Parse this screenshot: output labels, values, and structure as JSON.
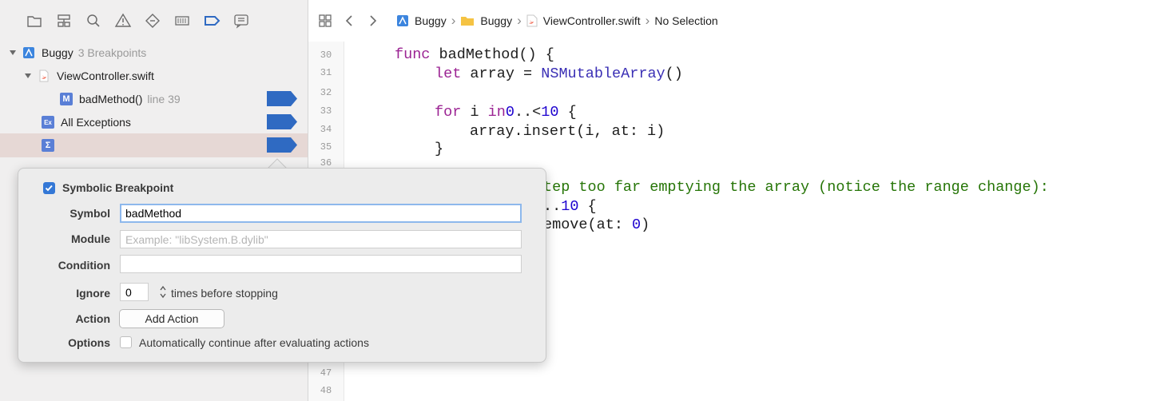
{
  "navigator": {
    "tabs": [
      "folder-icon",
      "source-control-icon",
      "find-icon",
      "issue-icon",
      "test-icon",
      "debug-icon",
      "breakpoint-icon",
      "report-icon"
    ],
    "project": {
      "name": "Buggy",
      "meta": "3 Breakpoints"
    },
    "file": {
      "name": "ViewController.swift"
    },
    "method_bp": {
      "badge": "M",
      "name": "badMethod()",
      "meta": "line 39"
    },
    "exceptions_bp": {
      "badge": "Ex",
      "name": "All Exceptions"
    },
    "symbolic_bp": {
      "badge": "Σ"
    }
  },
  "jumpbar": {
    "crumbs": [
      "Buggy",
      "Buggy",
      "ViewController.swift",
      "No Selection"
    ]
  },
  "editor": {
    "line_numbers": [
      "30",
      "31",
      "32",
      "33",
      "34",
      "35",
      "36",
      "47",
      "48"
    ],
    "code": {
      "l30_kw": "func",
      "l30_rest": " badMethod() {",
      "l31_kw": "let",
      "l31_mid": " array = ",
      "l31_type": "NSMutableArray",
      "l31_end": "()",
      "l33_kw1": "for",
      "l33_mid": " i ",
      "l33_kw2": "in",
      "l33_num1": "0",
      "l33_op": "..<",
      "l33_num2": "10",
      "l33_end": " {",
      "l34_a": "array.insert(i, at: i)",
      "l35": "}",
      "l37_comment": "tep too far emptying the array (notice the range change):",
      "l38_a": "..",
      "l38_num": "10",
      "l38_b": " {",
      "l39_a": "emove(at: ",
      "l39_num": "0",
      "l39_b": ")"
    }
  },
  "popover": {
    "title": "Symbolic Breakpoint",
    "enabled": true,
    "symbol_label": "Symbol",
    "symbol_value": "badMethod",
    "module_label": "Module",
    "module_placeholder": "Example: \"libSystem.B.dylib\"",
    "condition_label": "Condition",
    "condition_value": "",
    "ignore_label": "Ignore",
    "ignore_value": "0",
    "ignore_suffix": "times before stopping",
    "action_label": "Action",
    "add_action": "Add Action",
    "options_label": "Options",
    "options_text": "Automatically continue after evaluating actions",
    "options_checked": false
  },
  "colors": {
    "breakpoint": "#2f6ac2",
    "accent": "#3478d6",
    "selected_row": "#e6d8d5"
  }
}
